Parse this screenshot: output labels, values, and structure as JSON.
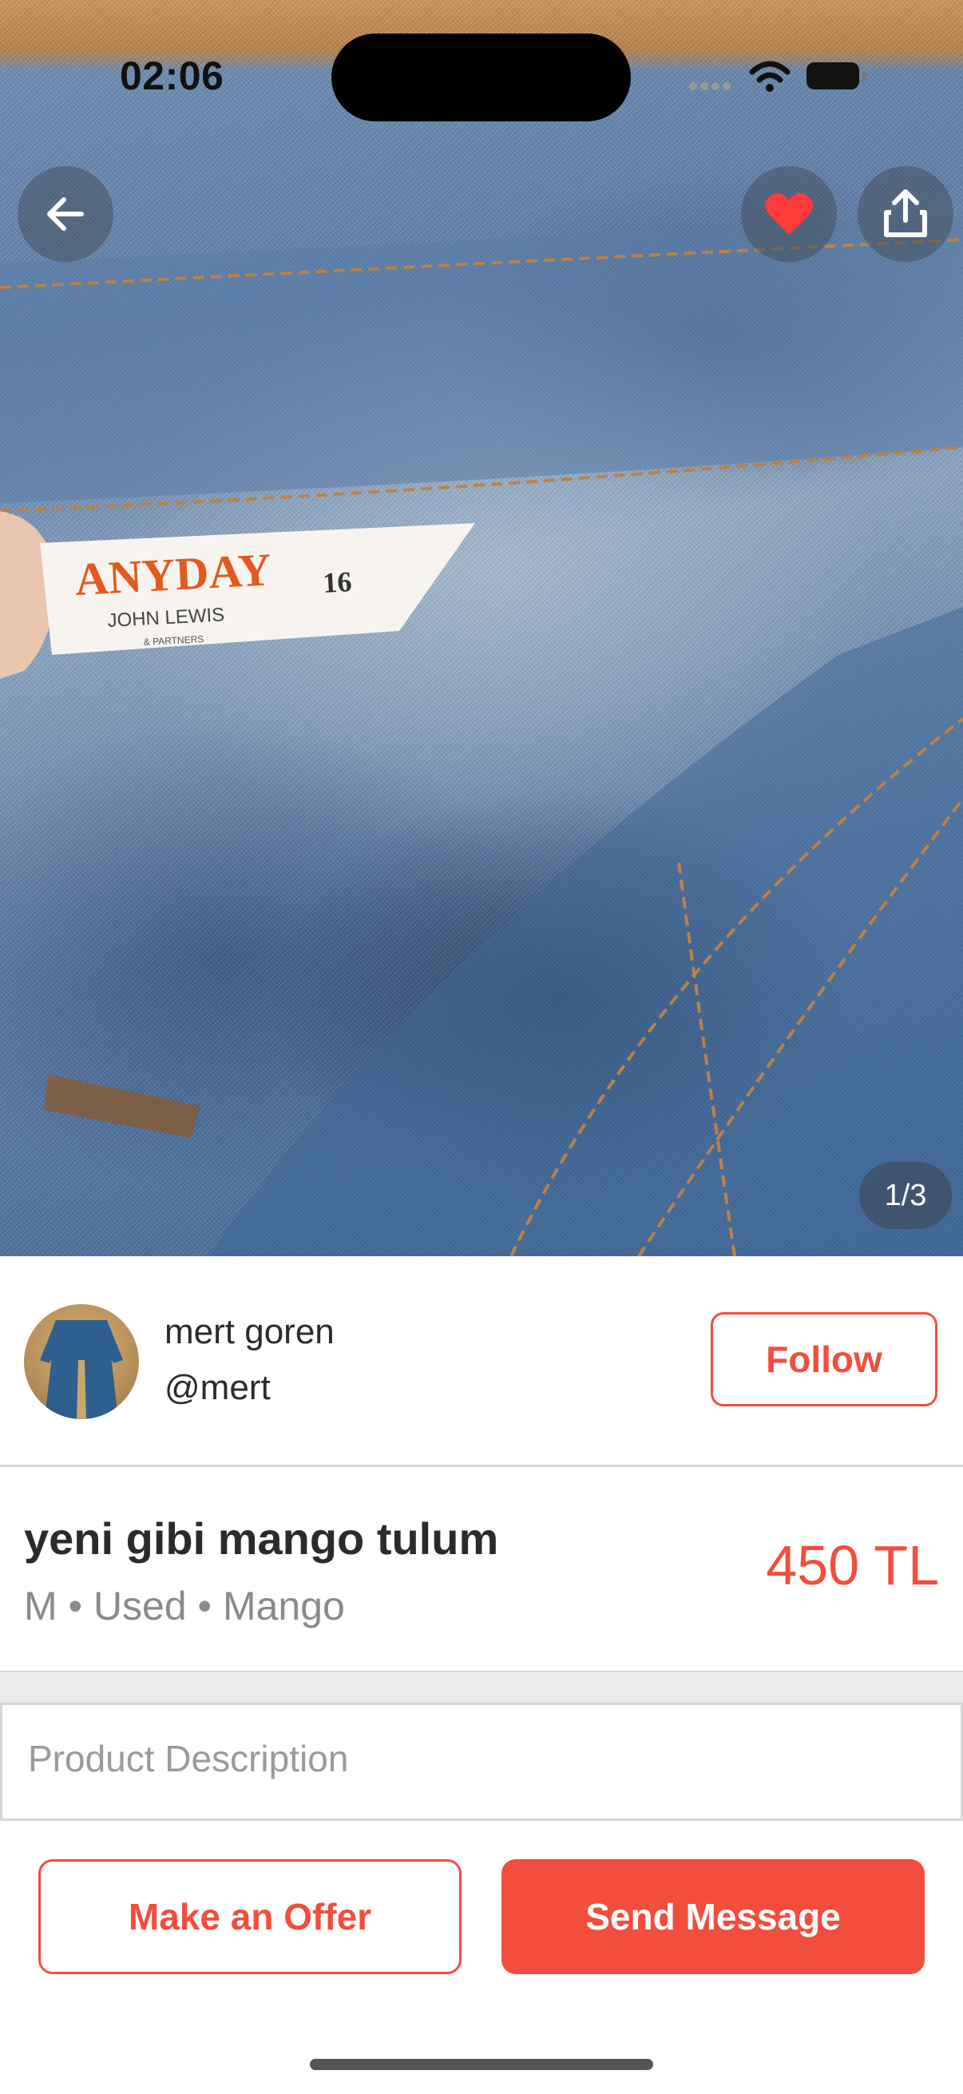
{
  "status_bar": {
    "time": "02:06"
  },
  "hero": {
    "label_brand": "ANYDAY",
    "label_size": "16",
    "label_line2": "JOHN LEWIS",
    "label_line3": "& PARTNERS",
    "image_counter": "1/3",
    "favorited": true
  },
  "seller": {
    "name": "mert goren",
    "handle": "@mert",
    "follow_label": "Follow"
  },
  "product": {
    "title": "yeni gibi mango tulum",
    "meta": "M • Used • Mango",
    "price": "450 TL"
  },
  "description": {
    "placeholder": "Product Description"
  },
  "actions": {
    "offer_label": "Make an Offer",
    "message_label": "Send Message"
  },
  "colors": {
    "accent": "#f24d3d",
    "favorite": "#ff3b3b"
  },
  "icons": [
    "back-arrow-icon",
    "heart-icon",
    "share-icon",
    "wifi-icon",
    "battery-icon",
    "signal-icon"
  ]
}
